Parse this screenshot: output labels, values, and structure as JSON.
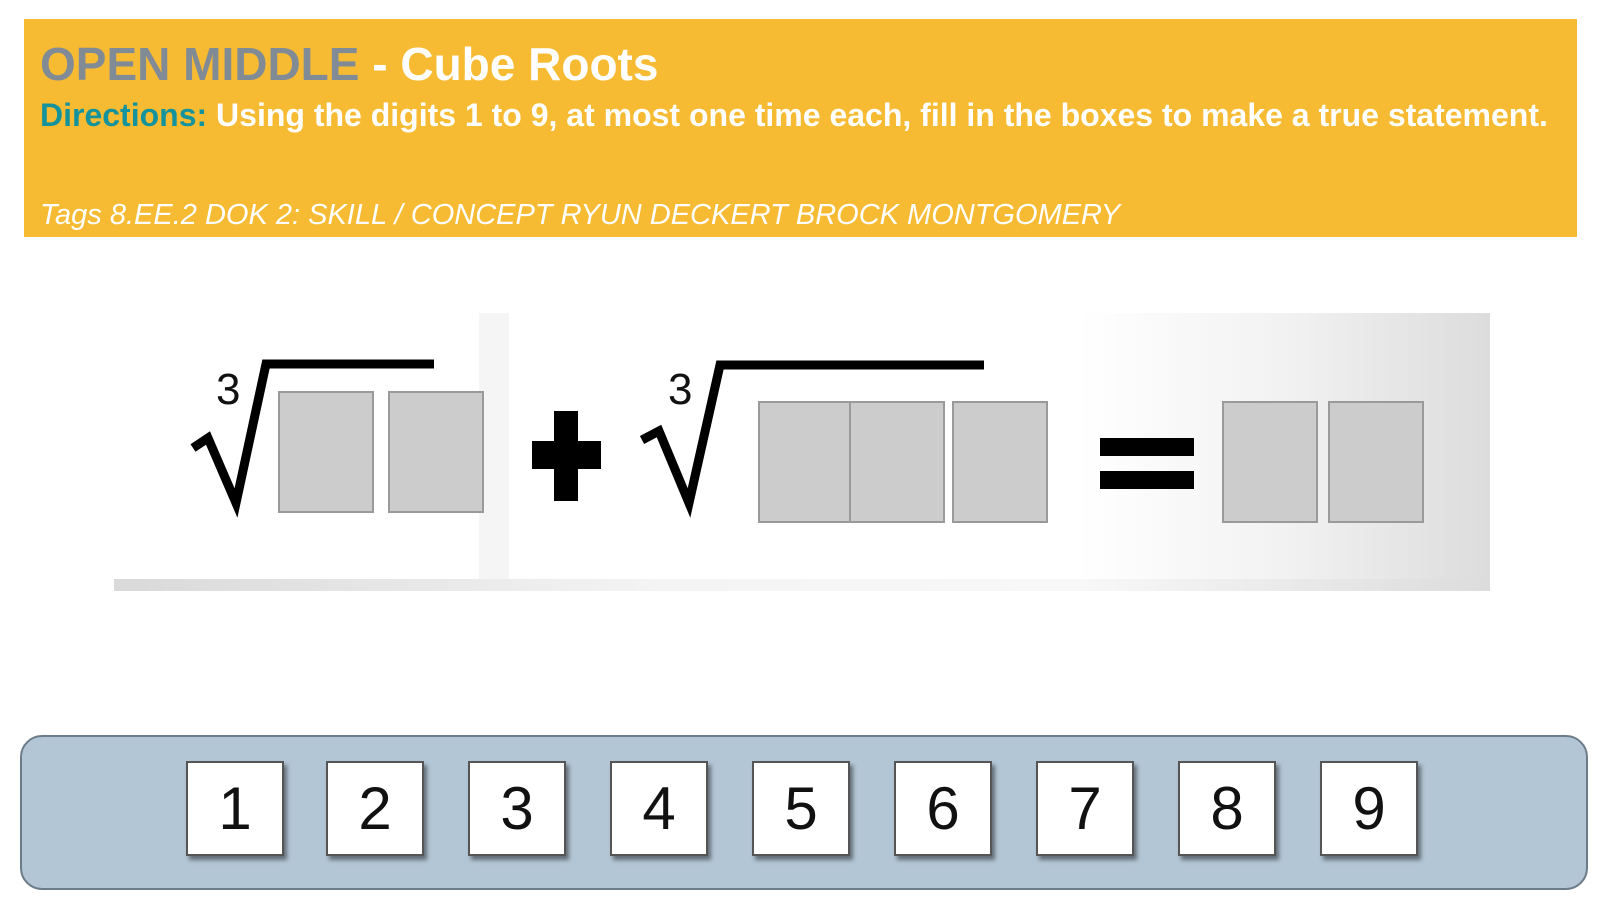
{
  "header": {
    "title_prefix": "OPEN MIDDLE",
    "title_suffix": " - Cube Roots",
    "directions_label": "Directions:",
    "directions_text": " Using the digits 1 to 9, at most one time each, fill in the boxes to make a true statement.",
    "tags": "Tags 8.EE.2 DOK 2: SKILL / CONCEPT RYUN DECKERT  BROCK MONTGOMERY"
  },
  "equation": {
    "root_index_1": "3",
    "root_index_2": "3"
  },
  "digits": [
    "1",
    "2",
    "3",
    "4",
    "5",
    "6",
    "7",
    "8",
    "9"
  ],
  "colors": {
    "banner": "#f7bb33",
    "title_gray": "#808b96",
    "directions_teal": "#14939c",
    "answer_box": "#cccccc",
    "tray": "#b3c6d5"
  }
}
